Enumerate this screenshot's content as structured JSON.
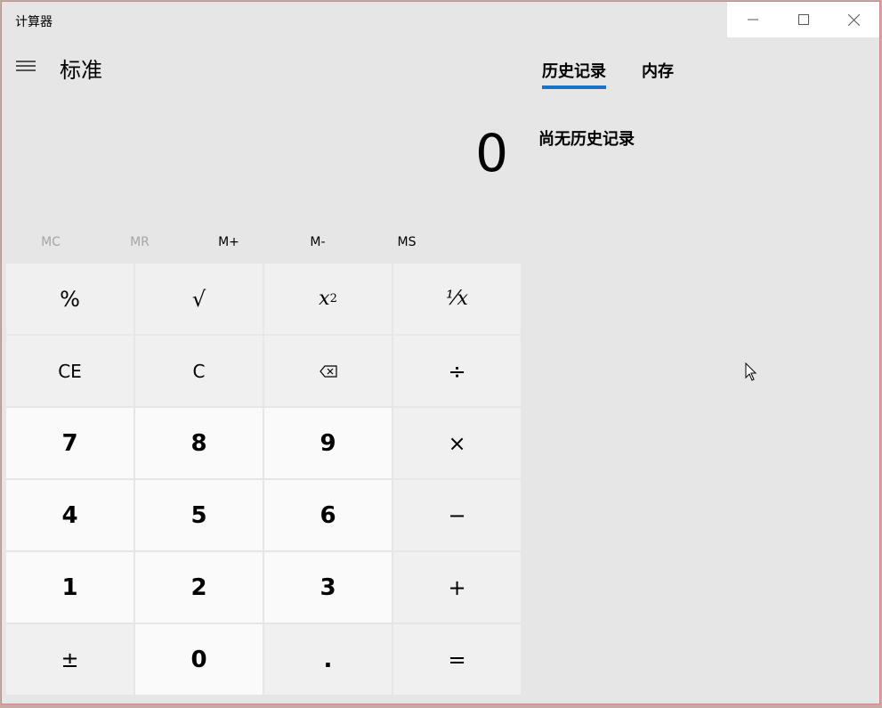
{
  "window": {
    "title": "计算器",
    "mode_title": "标准",
    "accent": "#1a73c4"
  },
  "display": {
    "value": "0"
  },
  "memory": {
    "buttons": [
      {
        "label": "MC",
        "enabled": false
      },
      {
        "label": "MR",
        "enabled": false
      },
      {
        "label": "M+",
        "enabled": true
      },
      {
        "label": "M-",
        "enabled": true
      },
      {
        "label": "MS",
        "enabled": true
      }
    ]
  },
  "keys": {
    "percent": "%",
    "sqrt": "√",
    "square_base": "x",
    "square_exp": "2",
    "reciprocal": "⅟x",
    "clear_entry": "CE",
    "clear": "C",
    "backspace_icon": "backspace-icon",
    "divide": "÷",
    "seven": "7",
    "eight": "8",
    "nine": "9",
    "multiply": "×",
    "four": "4",
    "five": "5",
    "six": "6",
    "minus": "−",
    "one": "1",
    "two": "2",
    "three": "3",
    "plus": "+",
    "negate": "±",
    "zero": "0",
    "decimal": ".",
    "equals": "="
  },
  "side_panel": {
    "tabs": [
      {
        "label": "历史记录",
        "active": true
      },
      {
        "label": "内存",
        "active": false
      }
    ],
    "empty_message": "尚无历史记录"
  }
}
